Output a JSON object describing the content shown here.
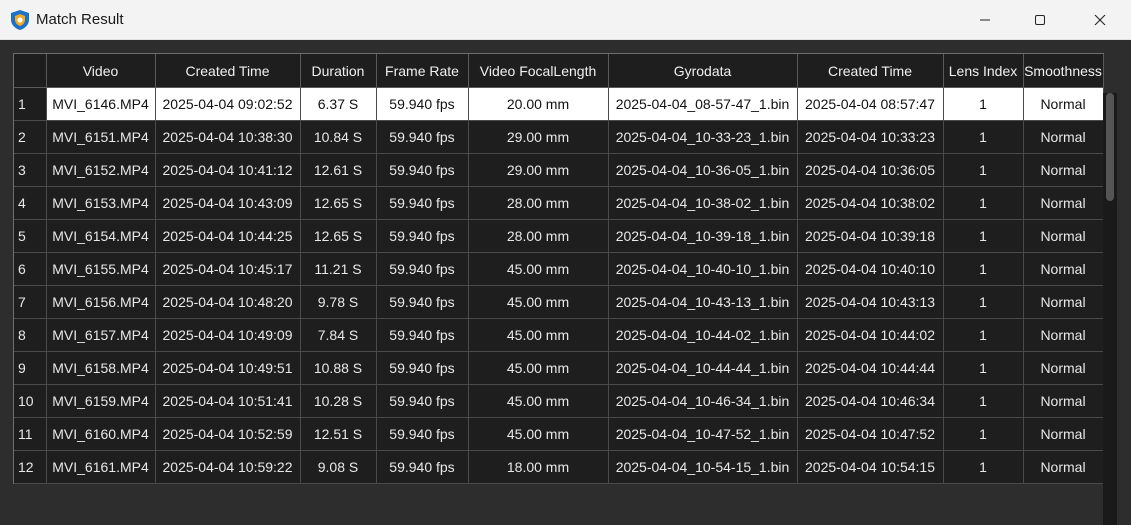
{
  "window": {
    "title": "Match Result",
    "icon": "app-logo-icon",
    "controls": [
      "minimize-icon",
      "maximize-icon",
      "close-icon"
    ]
  },
  "table": {
    "columns": [
      "",
      "Video",
      "Created Time",
      "Duration",
      "Frame Rate",
      "Video FocalLength",
      "Gyrodata",
      "Created Time",
      "Lens Index",
      "Smoothness"
    ],
    "rows": [
      [
        "1",
        "MVI_6146.MP4",
        "2025-04-04 09:02:52",
        "6.37 S",
        "59.940 fps",
        "20.00 mm",
        "2025-04-04_08-57-47_1.bin",
        "2025-04-04 08:57:47",
        "1",
        "Normal"
      ],
      [
        "2",
        "MVI_6151.MP4",
        "2025-04-04 10:38:30",
        "10.84 S",
        "59.940 fps",
        "29.00 mm",
        "2025-04-04_10-33-23_1.bin",
        "2025-04-04 10:33:23",
        "1",
        "Normal"
      ],
      [
        "3",
        "MVI_6152.MP4",
        "2025-04-04 10:41:12",
        "12.61 S",
        "59.940 fps",
        "29.00 mm",
        "2025-04-04_10-36-05_1.bin",
        "2025-04-04 10:36:05",
        "1",
        "Normal"
      ],
      [
        "4",
        "MVI_6153.MP4",
        "2025-04-04 10:43:09",
        "12.65 S",
        "59.940 fps",
        "28.00 mm",
        "2025-04-04_10-38-02_1.bin",
        "2025-04-04 10:38:02",
        "1",
        "Normal"
      ],
      [
        "5",
        "MVI_6154.MP4",
        "2025-04-04 10:44:25",
        "12.65 S",
        "59.940 fps",
        "28.00 mm",
        "2025-04-04_10-39-18_1.bin",
        "2025-04-04 10:39:18",
        "1",
        "Normal"
      ],
      [
        "6",
        "MVI_6155.MP4",
        "2025-04-04 10:45:17",
        "11.21 S",
        "59.940 fps",
        "45.00 mm",
        "2025-04-04_10-40-10_1.bin",
        "2025-04-04 10:40:10",
        "1",
        "Normal"
      ],
      [
        "7",
        "MVI_6156.MP4",
        "2025-04-04 10:48:20",
        "9.78 S",
        "59.940 fps",
        "45.00 mm",
        "2025-04-04_10-43-13_1.bin",
        "2025-04-04 10:43:13",
        "1",
        "Normal"
      ],
      [
        "8",
        "MVI_6157.MP4",
        "2025-04-04 10:49:09",
        "7.84 S",
        "59.940 fps",
        "45.00 mm",
        "2025-04-04_10-44-02_1.bin",
        "2025-04-04 10:44:02",
        "1",
        "Normal"
      ],
      [
        "9",
        "MVI_6158.MP4",
        "2025-04-04 10:49:51",
        "10.88 S",
        "59.940 fps",
        "45.00 mm",
        "2025-04-04_10-44-44_1.bin",
        "2025-04-04 10:44:44",
        "1",
        "Normal"
      ],
      [
        "10",
        "MVI_6159.MP4",
        "2025-04-04 10:51:41",
        "10.28 S",
        "59.940 fps",
        "45.00 mm",
        "2025-04-04_10-46-34_1.bin",
        "2025-04-04 10:46:34",
        "1",
        "Normal"
      ],
      [
        "11",
        "MVI_6160.MP4",
        "2025-04-04 10:52:59",
        "12.51 S",
        "59.940 fps",
        "45.00 mm",
        "2025-04-04_10-47-52_1.bin",
        "2025-04-04 10:47:52",
        "1",
        "Normal"
      ],
      [
        "12",
        "MVI_6161.MP4",
        "2025-04-04 10:59:22",
        "9.08 S",
        "59.940 fps",
        "18.00 mm",
        "2025-04-04_10-54-15_1.bin",
        "2025-04-04 10:54:15",
        "1",
        "Normal"
      ]
    ],
    "selected_row": 0
  },
  "colors": {
    "titlebar": "#f3f3f3",
    "background": "#2d2d2d",
    "grid": "#1e1e1e",
    "selected": "#ffffff"
  }
}
